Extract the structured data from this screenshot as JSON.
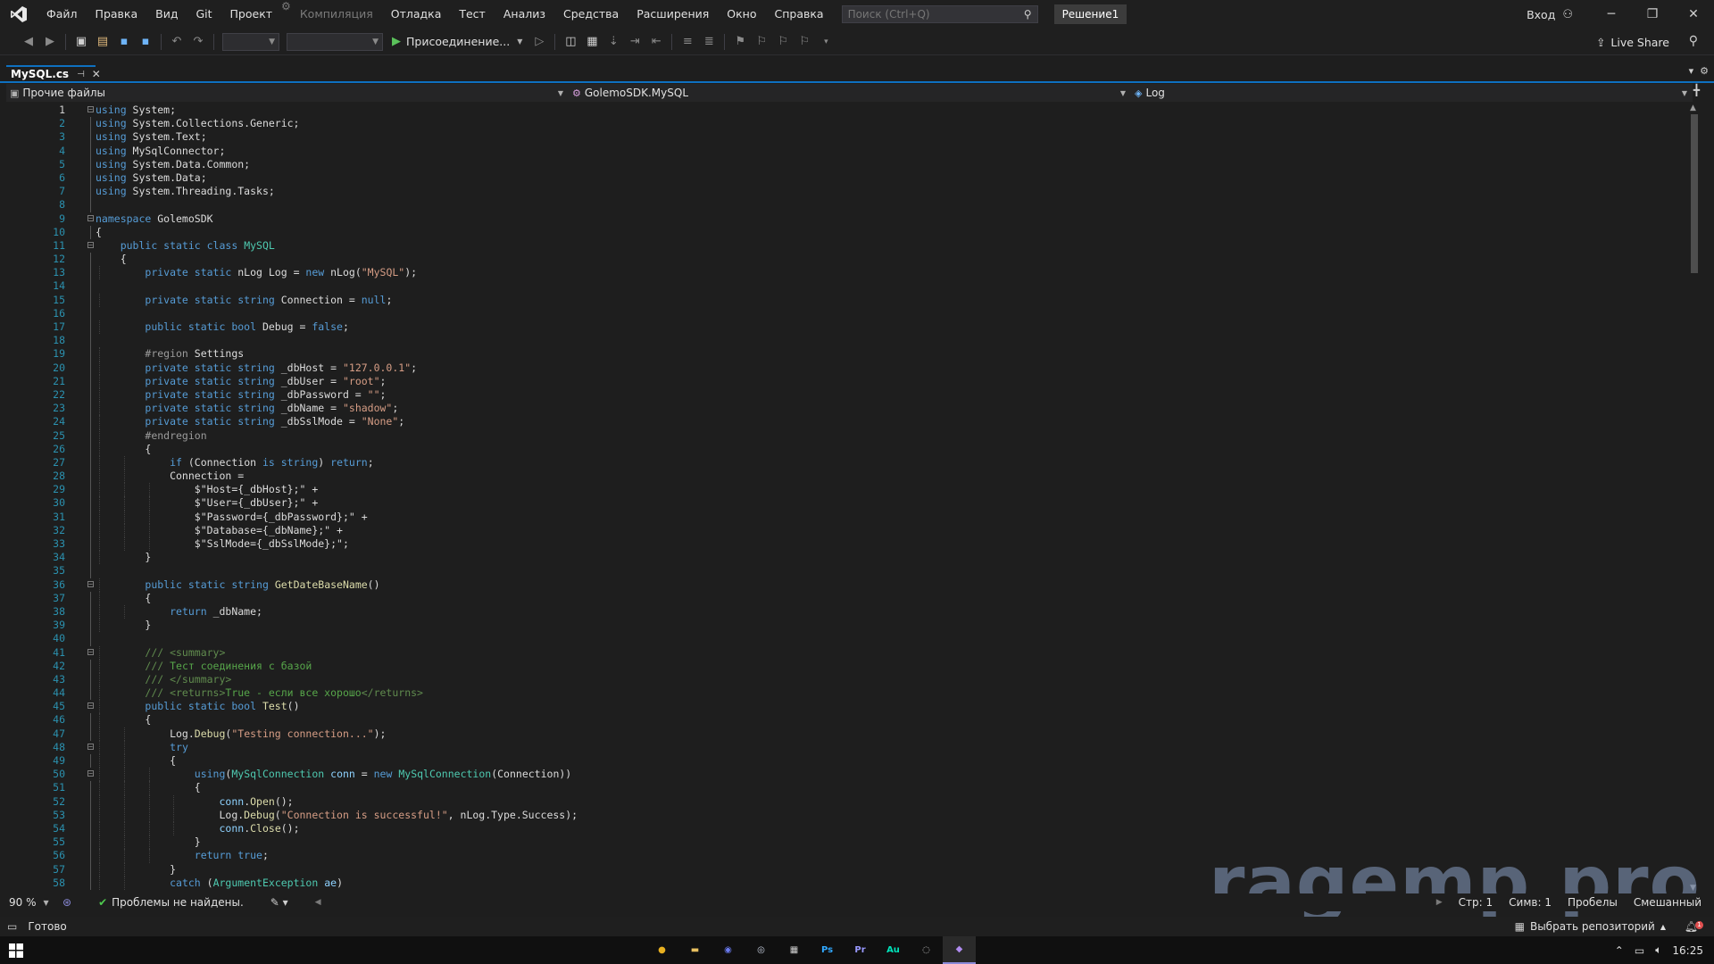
{
  "menu": {
    "items": [
      "Файл",
      "Правка",
      "Вид",
      "Git",
      "Проект",
      "Компиляция",
      "Отладка",
      "Тест",
      "Анализ",
      "Средства",
      "Расширения",
      "Окно",
      "Справка"
    ],
    "search_placeholder": "Поиск (Ctrl+Q)",
    "solution": "Решение1",
    "signin": "Вход"
  },
  "toolbar": {
    "attach_label": "Присоединение...",
    "liveshare_label": "Live Share"
  },
  "tab": {
    "label": "MySQL.cs"
  },
  "navbar": {
    "project": "Прочие файлы",
    "type": "GolemoSDK.MySQL",
    "member": "Log"
  },
  "code_lines": [
    [
      [
        "kw",
        "using"
      ],
      [
        "pl",
        " System;"
      ]
    ],
    [
      [
        "kw",
        "using"
      ],
      [
        "pl",
        " System.Collections.Generic;"
      ]
    ],
    [
      [
        "kw",
        "using"
      ],
      [
        "pl",
        " System.Text;"
      ]
    ],
    [
      [
        "kw",
        "using"
      ],
      [
        "pl",
        " MySqlConnector;"
      ]
    ],
    [
      [
        "kw",
        "using"
      ],
      [
        "pl",
        " System.Data.Common;"
      ]
    ],
    [
      [
        "kw",
        "using"
      ],
      [
        "pl",
        " System.Data;"
      ]
    ],
    [
      [
        "kw",
        "using"
      ],
      [
        "pl",
        " System.Threading.Tasks;"
      ]
    ],
    [],
    [
      [
        "kw",
        "namespace"
      ],
      [
        "pl",
        " GolemoSDK"
      ]
    ],
    [
      [
        "pl",
        "{"
      ]
    ],
    [
      [
        "pl",
        "    "
      ],
      [
        "kw",
        "public static class"
      ],
      [
        "pl",
        " "
      ],
      [
        "ty",
        "MySQL"
      ]
    ],
    [
      [
        "pl",
        "    {"
      ]
    ],
    [
      [
        "pl",
        "        "
      ],
      [
        "kw",
        "private static"
      ],
      [
        "pl",
        " nLog Log = "
      ],
      [
        "kw",
        "new"
      ],
      [
        "pl",
        " nLog("
      ],
      [
        "str",
        "\"MySQL\""
      ],
      [
        "pl",
        ");"
      ]
    ],
    [],
    [
      [
        "pl",
        "        "
      ],
      [
        "kw",
        "private static string"
      ],
      [
        "pl",
        " Connection = "
      ],
      [
        "kw",
        "null"
      ],
      [
        "pl",
        ";"
      ]
    ],
    [],
    [
      [
        "pl",
        "        "
      ],
      [
        "kw",
        "public static bool"
      ],
      [
        "pl",
        " Debug = "
      ],
      [
        "kw",
        "false"
      ],
      [
        "pl",
        ";"
      ]
    ],
    [],
    [
      [
        "pl",
        "        "
      ],
      [
        "pp",
        "#region"
      ],
      [
        "pl",
        " Settings"
      ]
    ],
    [
      [
        "pl",
        "        "
      ],
      [
        "kw",
        "private static string"
      ],
      [
        "pl",
        " _dbHost = "
      ],
      [
        "str",
        "\"127.0.0.1\""
      ],
      [
        "pl",
        ";"
      ]
    ],
    [
      [
        "pl",
        "        "
      ],
      [
        "kw",
        "private static string"
      ],
      [
        "pl",
        " _dbUser = "
      ],
      [
        "str",
        "\"root\""
      ],
      [
        "pl",
        ";"
      ]
    ],
    [
      [
        "pl",
        "        "
      ],
      [
        "kw",
        "private static string"
      ],
      [
        "pl",
        " _dbPassword = "
      ],
      [
        "str",
        "\"\""
      ],
      [
        "pl",
        ";"
      ]
    ],
    [
      [
        "pl",
        "        "
      ],
      [
        "kw",
        "private static string"
      ],
      [
        "pl",
        " _dbName = "
      ],
      [
        "str",
        "\"shadow\""
      ],
      [
        "pl",
        ";"
      ]
    ],
    [
      [
        "pl",
        "        "
      ],
      [
        "kw",
        "private static string"
      ],
      [
        "pl",
        " _dbSslMode = "
      ],
      [
        "str",
        "\"None\""
      ],
      [
        "pl",
        ";"
      ]
    ],
    [
      [
        "pl",
        "        "
      ],
      [
        "pp",
        "#endregion"
      ]
    ],
    [
      [
        "pl",
        "        {"
      ]
    ],
    [
      [
        "pl",
        "            "
      ],
      [
        "kw",
        "if"
      ],
      [
        "pl",
        " (Connection "
      ],
      [
        "kw",
        "is string"
      ],
      [
        "pl",
        ") "
      ],
      [
        "kw",
        "return"
      ],
      [
        "pl",
        ";"
      ]
    ],
    [
      [
        "pl",
        "            Connection ="
      ]
    ],
    [
      [
        "pl",
        "                $\"Host={_dbHost};\" +"
      ]
    ],
    [
      [
        "pl",
        "                $\"User={_dbUser};\" +"
      ]
    ],
    [
      [
        "pl",
        "                $\"Password={_dbPassword};\" +"
      ]
    ],
    [
      [
        "pl",
        "                $\"Database={_dbName};\" +"
      ]
    ],
    [
      [
        "pl",
        "                $\"SslMode={_dbSslMode};\";"
      ]
    ],
    [
      [
        "pl",
        "        }"
      ]
    ],
    [],
    [
      [
        "pl",
        "        "
      ],
      [
        "kw",
        "public static string"
      ],
      [
        "pl",
        " "
      ],
      [
        "fn",
        "GetDateBaseName"
      ],
      [
        "pl",
        "()"
      ]
    ],
    [
      [
        "pl",
        "        {"
      ]
    ],
    [
      [
        "pl",
        "            "
      ],
      [
        "kw",
        "return"
      ],
      [
        "pl",
        " _dbName;"
      ]
    ],
    [
      [
        "pl",
        "        }"
      ]
    ],
    [],
    [
      [
        "pl",
        "        "
      ],
      [
        "cmg",
        "/// <summary>"
      ]
    ],
    [
      [
        "pl",
        "        "
      ],
      [
        "cmg",
        "/// "
      ],
      [
        "cm",
        "Тест соединения с базой"
      ]
    ],
    [
      [
        "pl",
        "        "
      ],
      [
        "cmg",
        "/// </summary>"
      ]
    ],
    [
      [
        "pl",
        "        "
      ],
      [
        "cmg",
        "/// <returns>"
      ],
      [
        "cm",
        "True - если все хорошо"
      ],
      [
        "cmg",
        "</returns>"
      ]
    ],
    [
      [
        "pl",
        "        "
      ],
      [
        "kw",
        "public static bool"
      ],
      [
        "pl",
        " "
      ],
      [
        "fn",
        "Test"
      ],
      [
        "pl",
        "()"
      ]
    ],
    [
      [
        "pl",
        "        {"
      ]
    ],
    [
      [
        "pl",
        "            Log."
      ],
      [
        "fn",
        "Debug"
      ],
      [
        "pl",
        "("
      ],
      [
        "str",
        "\"Testing connection...\""
      ],
      [
        "pl",
        ");"
      ]
    ],
    [
      [
        "pl",
        "            "
      ],
      [
        "kw",
        "try"
      ]
    ],
    [
      [
        "pl",
        "            {"
      ]
    ],
    [
      [
        "pl",
        "                "
      ],
      [
        "kw",
        "using"
      ],
      [
        "pl",
        "("
      ],
      [
        "ty",
        "MySqlConnection"
      ],
      [
        "pl",
        " "
      ],
      [
        "ct",
        "conn"
      ],
      [
        "pl",
        " = "
      ],
      [
        "kw",
        "new"
      ],
      [
        "pl",
        " "
      ],
      [
        "ty",
        "MySqlConnection"
      ],
      [
        "pl",
        "(Connection))"
      ]
    ],
    [
      [
        "pl",
        "                {"
      ]
    ],
    [
      [
        "pl",
        "                    "
      ],
      [
        "ct",
        "conn"
      ],
      [
        "pl",
        "."
      ],
      [
        "fn",
        "Open"
      ],
      [
        "pl",
        "();"
      ]
    ],
    [
      [
        "pl",
        "                    Log."
      ],
      [
        "fn",
        "Debug"
      ],
      [
        "pl",
        "("
      ],
      [
        "str",
        "\"Connection is successful!\""
      ],
      [
        "pl",
        ", nLog.Type.Success);"
      ]
    ],
    [
      [
        "pl",
        "                    "
      ],
      [
        "ct",
        "conn"
      ],
      [
        "pl",
        "."
      ],
      [
        "fn",
        "Close"
      ],
      [
        "pl",
        "();"
      ]
    ],
    [
      [
        "pl",
        "                }"
      ]
    ],
    [
      [
        "pl",
        "                "
      ],
      [
        "kw",
        "return true"
      ],
      [
        "pl",
        ";"
      ]
    ],
    [
      [
        "pl",
        "            }"
      ]
    ],
    [
      [
        "pl",
        "            "
      ],
      [
        "kw",
        "catch"
      ],
      [
        "pl",
        " ("
      ],
      [
        "ty",
        "ArgumentException"
      ],
      [
        "pl",
        " "
      ],
      [
        "ct",
        "ae"
      ],
      [
        "pl",
        ")"
      ]
    ]
  ],
  "fold_lines": [
    1,
    9,
    11,
    36,
    41,
    45,
    48,
    50
  ],
  "current_line": 1,
  "editor_status": {
    "zoom": "90 %",
    "problems": "Проблемы не найдены.",
    "line": "Стр: 1",
    "col": "Симв: 1",
    "spaces": "Пробелы",
    "eol": "Смешанный"
  },
  "statusbar": {
    "ready": "Готово",
    "repo": "Выбрать репозиторий",
    "notifications": "1"
  },
  "taskbar": {
    "apps": [
      "chrome",
      "explorer",
      "discord",
      "steam",
      "calculator",
      "photoshop",
      "premiere",
      "audition",
      "obs",
      "visual-studio"
    ],
    "time": "16:25"
  },
  "watermark": "ragemp.pro"
}
